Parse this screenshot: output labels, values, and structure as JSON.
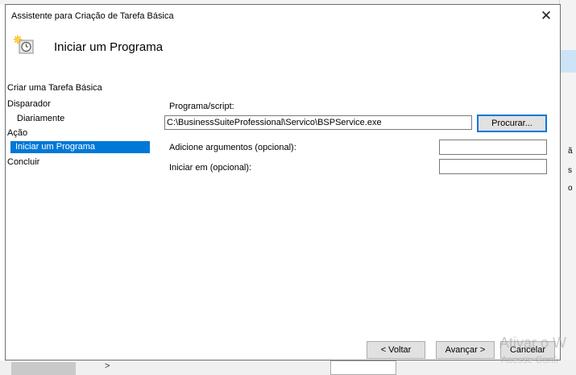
{
  "dialog": {
    "title": "Assistente para Criação de Tarefa Básica",
    "close_icon": "close-icon",
    "header_icon": "clock-icon",
    "header_title": "Iniciar um Programa"
  },
  "nav": {
    "items": [
      {
        "label": "Criar uma Tarefa Básica"
      },
      {
        "label": "Disparador"
      },
      {
        "label": "Diariamente"
      },
      {
        "label": "Ação"
      },
      {
        "label": "Iniciar um Programa",
        "selected": true
      },
      {
        "label": "Concluir"
      }
    ]
  },
  "form": {
    "program_label": "Programa/script:",
    "program_value": "C:\\BusinessSuiteProfessional\\Servico\\BSPService.exe",
    "browse_label": "Procurar...",
    "args_label": "Adicione argumentos (opcional):",
    "args_value": "",
    "start_in_label": "Iniciar em (opcional):",
    "start_in_value": ""
  },
  "footer": {
    "back_label": "< Voltar",
    "next_label": "Avançar >",
    "cancel_label": "Cancelar"
  },
  "background": {
    "watermark_line1": "Ativar o W",
    "watermark_line2": "Acesse Confi",
    "right_chars": [
      "ã",
      "s",
      "o"
    ],
    "bottom_text": ">"
  },
  "colors": {
    "selection": "#0078d7",
    "button_face": "#e1e1e1",
    "dialog_border": "#6f6f6f"
  }
}
